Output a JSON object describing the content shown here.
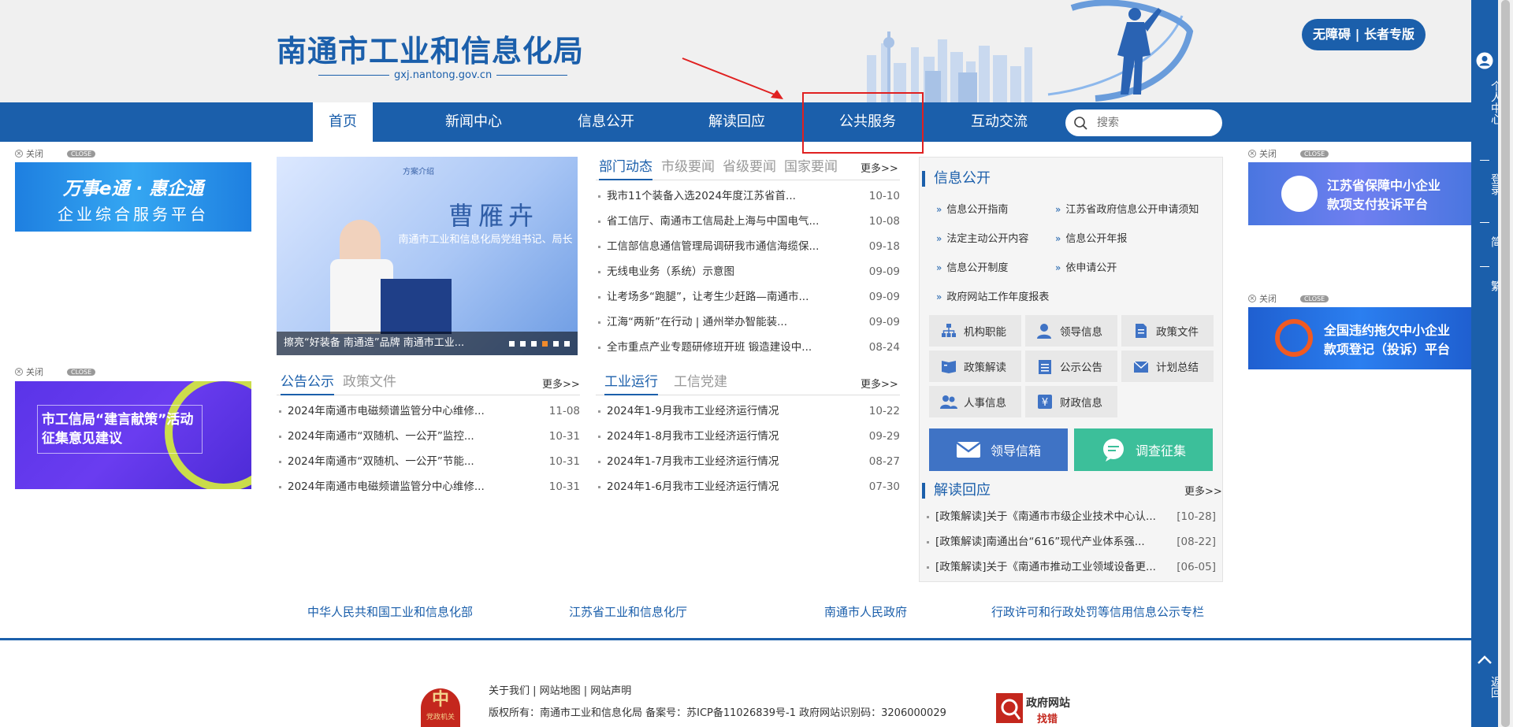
{
  "header": {
    "title": "南通市工业和信息化局",
    "domain": "gxj.nantong.gov.cn",
    "accessibility_label": "无障碍 | 长者专版"
  },
  "nav": {
    "items": [
      "首页",
      "新闻中心",
      "信息公开",
      "解读回应",
      "公共服务",
      "互动交流"
    ],
    "active": "首页",
    "search_placeholder": "搜索"
  },
  "sidebar": {
    "personal": "个人中心",
    "login": "登录",
    "simplified": "简",
    "traditional": "繁",
    "back": "返回"
  },
  "ads": {
    "close_label": "关闭",
    "close_tag": "CLOSE",
    "left_top_line1": "万事e通 · 惠企通",
    "left_top_line2": "企业综合服务平台",
    "left_bottom_line1": "市工信局“建言献策”活动",
    "left_bottom_line2": "征集意见建议",
    "right_top_line1": "江苏省保障中小企业",
    "right_top_line2": "款项支付投诉平台",
    "right_bottom_line1": "全国违约拖欠中小企业",
    "right_bottom_line2": "款项登记（投诉）平台"
  },
  "banner": {
    "tag": "方案介绍",
    "name": "曹雁卉",
    "subtitle": "南通市工业和信息化局党组书记、局长",
    "caption": "擦亮“好装备 南通造”品牌 南通市工业...",
    "active_dot": 4,
    "dot_count": 6
  },
  "news": {
    "tabs": [
      "部门动态",
      "市级要闻",
      "省级要闻",
      "国家要闻"
    ],
    "more": "更多>>",
    "items": [
      {
        "title": "我市11个装备入选2024年度江苏省首...",
        "date": "10-10"
      },
      {
        "title": "省工信厅、南通市工信局赴上海与中国电气...",
        "date": "10-08"
      },
      {
        "title": "工信部信息通信管理局调研我市通信海缆保...",
        "date": "09-18"
      },
      {
        "title": "无线电业务（系统）示意图",
        "date": "09-09"
      },
      {
        "title": "让考场多“跑腿”，让考生少赶路—南通市...",
        "date": "09-09"
      },
      {
        "title": "江海“两新”在行动 | 通州举办智能装...",
        "date": "09-09"
      },
      {
        "title": "全市重点产业专题研修班开班 锻造建设中...",
        "date": "08-24"
      }
    ]
  },
  "notice": {
    "tabs": [
      "公告公示",
      "政策文件"
    ],
    "more": "更多>>",
    "items": [
      {
        "title": "2024年南通市电磁频谱监管分中心维修...",
        "date": "11-08"
      },
      {
        "title": "2024年南通市“双随机、一公开”监控...",
        "date": "10-31"
      },
      {
        "title": "2024年南通市“双随机、一公开”节能...",
        "date": "10-31"
      },
      {
        "title": "2024年南通市电磁频谱监管分中心维修...",
        "date": "10-31"
      }
    ]
  },
  "industry": {
    "tabs": [
      "工业运行",
      "工信党建"
    ],
    "more": "更多>>",
    "items": [
      {
        "title": "2024年1-9月我市工业经济运行情况",
        "date": "10-22"
      },
      {
        "title": "2024年1-8月我市工业经济运行情况",
        "date": "09-29"
      },
      {
        "title": "2024年1-7月我市工业经济运行情况",
        "date": "08-27"
      },
      {
        "title": "2024年1-6月我市工业经济运行情况",
        "date": "07-30"
      }
    ]
  },
  "info": {
    "title": "信息公开",
    "links": [
      "信息公开指南",
      "江苏省政府信息公开申请须知",
      "法定主动公开内容",
      "信息公开年报",
      "信息公开制度",
      "依申请公开",
      "政府网站工作年度报表"
    ],
    "buttons": [
      "机构职能",
      "领导信息",
      "政策文件",
      "政策解读",
      "公示公告",
      "计划总结",
      "人事信息",
      "财政信息"
    ],
    "mailbox": "领导信箱",
    "survey": "调查征集",
    "mailbox_color": "#3f73c5",
    "survey_color": "#3cbf9a"
  },
  "interpret": {
    "title": "解读回应",
    "more": "更多>>",
    "items": [
      {
        "title": "[政策解读]关于《南通市市级企业技术中心认...",
        "date": "[10-28]"
      },
      {
        "title": "[政策解读]南通出台“616”现代产业体系强...",
        "date": "[08-22]"
      },
      {
        "title": "[政策解读]关于《南通市推动工业领域设备更...",
        "date": "[06-05]"
      }
    ]
  },
  "footer": {
    "links": [
      "中华人民共和国工业和信息化部",
      "江苏省工业和信息化厅",
      "南通市人民政府",
      "行政许可和行政处罚等信用信息公示专栏"
    ],
    "about": "关于我们 | 网站地图 | 网站声明",
    "copyright": "版权所有：南通市工业和信息化局   备案号：苏ICP备11026839号-1   政府网站识别码：3206000029",
    "badge_text": "党政机关",
    "badge_char": "中",
    "error_title": "政府网站",
    "error_sub": "找错"
  },
  "colors": {
    "primary": "#1b5fab",
    "highlight": "#e02020"
  }
}
